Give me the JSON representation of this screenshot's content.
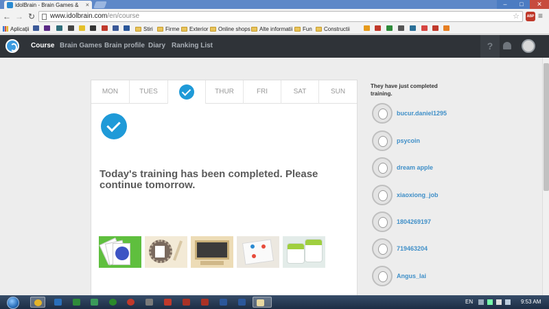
{
  "browser": {
    "tab_title": "idolBrain - Brain Games &",
    "url_host": "www.idolbrain.com",
    "url_path": "/en/course",
    "abp_label": "ABP",
    "bookmarks": [
      {
        "label": "Aplicații",
        "icon": "apps-icon"
      },
      {
        "label": "Stiri",
        "icon": "folder-icon"
      },
      {
        "label": "Firme",
        "icon": "folder-icon"
      },
      {
        "label": "Exterior",
        "icon": "folder-icon"
      },
      {
        "label": "Online shops",
        "icon": "folder-icon"
      },
      {
        "label": "Alte informatii",
        "icon": "folder-icon"
      },
      {
        "label": "Fun",
        "icon": "folder-icon"
      },
      {
        "label": "Constructii",
        "icon": "folder-icon"
      }
    ]
  },
  "site": {
    "nav": [
      {
        "label": "Course",
        "active": true
      },
      {
        "label": "Brain Games",
        "active": false
      },
      {
        "label": "Brain profile",
        "active": false
      },
      {
        "label": "Diary",
        "active": false
      },
      {
        "label": "Ranking List",
        "active": false
      }
    ],
    "help_label": "?"
  },
  "week": {
    "days": [
      "MON",
      "TUES",
      "",
      "THUR",
      "FRI",
      "SAT",
      "SUN"
    ],
    "completed_day_index": 2
  },
  "training": {
    "message": "Today's training has been completed. Please continue tomorrow.",
    "games": [
      "card-game-icon",
      "writing-seal-game-icon",
      "blackboard-game-icon",
      "board-game-icon",
      "dice-game-icon"
    ]
  },
  "sidebar": {
    "heading": "They have just completed training.",
    "users": [
      "bucur.daniel1295",
      "psycoin",
      "dream apple",
      "xiaoxiong_job",
      "1804269197",
      "719463204",
      "Angus_lai"
    ]
  },
  "taskbar": {
    "language": "EN",
    "time": "9:53 AM"
  },
  "colors": {
    "accent": "#1f9ad8",
    "header_bg": "#2f3338",
    "link": "#3f8fc8",
    "page_bg": "#ededed"
  }
}
